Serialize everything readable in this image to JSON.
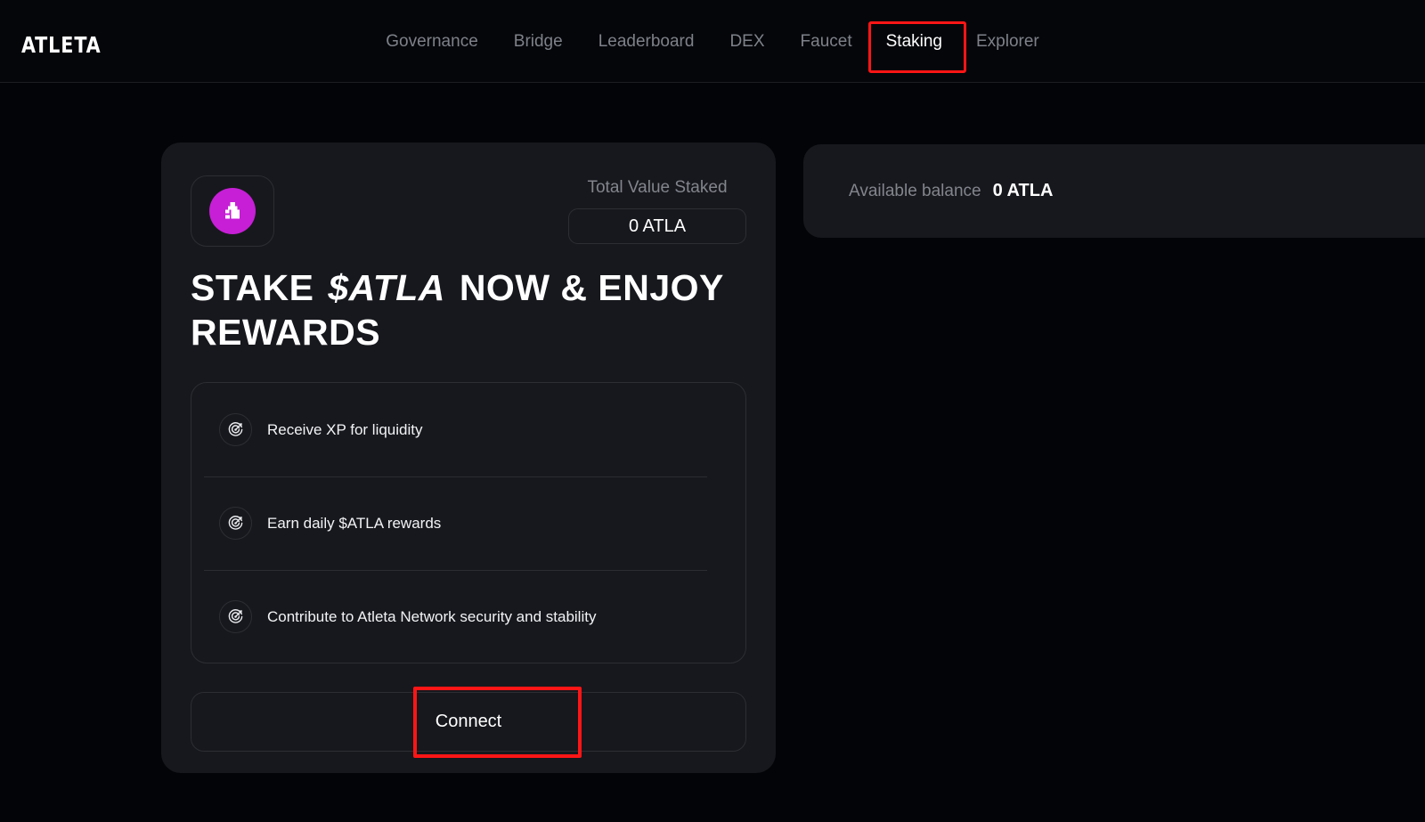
{
  "brand": {
    "logo_text": "ATLETA"
  },
  "nav": {
    "items": [
      {
        "label": "Governance",
        "active": false
      },
      {
        "label": "Bridge",
        "active": false
      },
      {
        "label": "Leaderboard",
        "active": false
      },
      {
        "label": "DEX",
        "active": false
      },
      {
        "label": "Faucet",
        "active": false
      },
      {
        "label": "Staking",
        "active": true
      },
      {
        "label": "Explorer",
        "active": false
      }
    ],
    "highlight_color": "#ff1515"
  },
  "stake_card": {
    "token_icon": "atleta-token-icon",
    "token_color": "#c61fd6",
    "total_value_staked_label": "Total Value Staked",
    "total_value_staked_amount": "0 ATLA",
    "headline_part1": "STAKE",
    "headline_ticker": "$ATLA",
    "headline_part2": "NOW & ENJOY REWARDS",
    "benefits": [
      {
        "icon": "target-arrow-icon",
        "text": "Receive XP for liquidity"
      },
      {
        "icon": "target-arrow-icon",
        "text": "Earn daily $ATLA rewards"
      },
      {
        "icon": "target-arrow-icon",
        "text": "Contribute to Atleta Network security and stability"
      }
    ],
    "connect_label": "Connect"
  },
  "balance_panel": {
    "label": "Available balance",
    "value": "0 ATLA"
  }
}
